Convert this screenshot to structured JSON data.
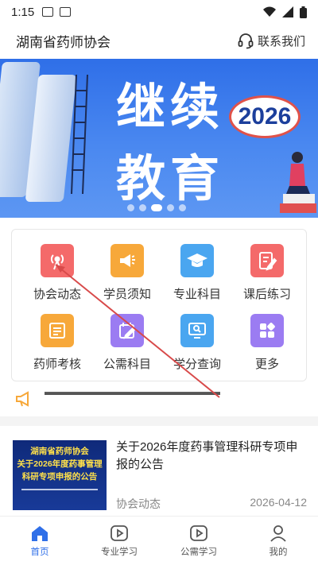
{
  "status": {
    "time": "1:15"
  },
  "header": {
    "title": "湖南省药师协会",
    "contact_label": "联系我们"
  },
  "banner": {
    "line1": "继续",
    "line2": "教育",
    "year": "2026"
  },
  "grid": [
    {
      "label": "协会动态",
      "icon": "broadcast-icon",
      "color": "#f46a6a"
    },
    {
      "label": "学员须知",
      "icon": "megaphone-icon",
      "color": "#f7a83a"
    },
    {
      "label": "专业科目",
      "icon": "graduation-cap-icon",
      "color": "#4aa6f0"
    },
    {
      "label": "课后练习",
      "icon": "edit-note-icon",
      "color": "#f46a6a"
    },
    {
      "label": "药师考核",
      "icon": "document-icon",
      "color": "#f7a83a"
    },
    {
      "label": "公需科目",
      "icon": "calendar-edit-icon",
      "color": "#9b7cf2"
    },
    {
      "label": "学分查询",
      "icon": "monitor-search-icon",
      "color": "#4aa6f0"
    },
    {
      "label": "更多",
      "icon": "apps-icon",
      "color": "#9b7cf2"
    }
  ],
  "notice": {
    "icon": "megaphone-icon"
  },
  "news": [
    {
      "thumb_line1": "湖南省药师协会",
      "thumb_line2": "关于2026年度药事管理",
      "thumb_line3": "科研专项申报的公告",
      "title": "关于2026年度药事管理科研专项申报的公告",
      "category": "协会动态",
      "date": "2026-04-12"
    }
  ],
  "tabs": [
    {
      "label": "首页",
      "icon": "home-icon",
      "active": true
    },
    {
      "label": "专业学习",
      "icon": "play-icon",
      "active": false
    },
    {
      "label": "公需学习",
      "icon": "play-icon",
      "active": false
    },
    {
      "label": "我的",
      "icon": "user-icon",
      "active": false
    }
  ],
  "colors": {
    "accent": "#2f6fe8",
    "annotation": "#d84a4a"
  }
}
